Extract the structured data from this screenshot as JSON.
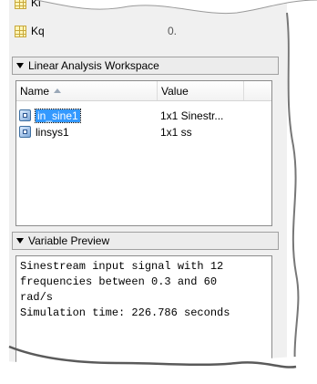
{
  "top_list": {
    "items": [
      {
        "label": "Ki",
        "icon": "table-icon"
      },
      {
        "label": "Kq",
        "icon": "table-icon",
        "value": "0."
      }
    ]
  },
  "workspace": {
    "title": "Linear Analysis Workspace",
    "columns": {
      "name": "Name",
      "value": "Value"
    },
    "rows": [
      {
        "name": "in_sine1",
        "value": "1x1 Sinestr...",
        "icon": "object-icon",
        "selected": true
      },
      {
        "name": "linsys1",
        "value": "1x1 ss",
        "icon": "object-icon",
        "selected": false
      }
    ]
  },
  "preview": {
    "title": "Variable Preview",
    "lines": [
      "Sinestream input signal with 12",
      "frequencies between 0.3 and 60",
      "rad/s",
      "Simulation time: 226.786 seconds"
    ]
  },
  "colors": {
    "selection": "#3399ff",
    "panel_bg": "#f0f0f0"
  }
}
